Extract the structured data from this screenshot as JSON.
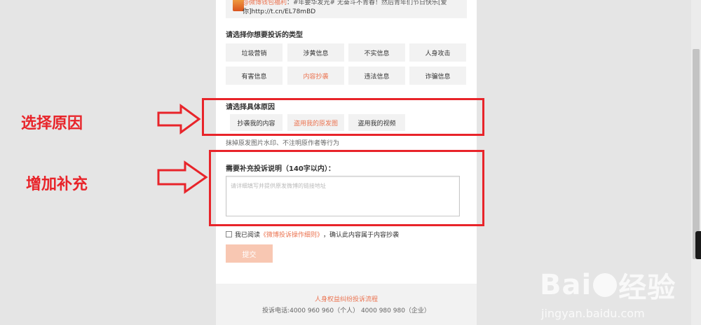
{
  "quote": {
    "line1_mention": "@微博钱包福利",
    "line1_rest": "：#年要华发光# 无奋斗不青春！然后青年们节日快乐[爱",
    "line2": "你]http://t.cn/EL78mBD"
  },
  "complaint_type": {
    "title": "请选择你想要投诉的类型",
    "options": [
      "垃圾营销",
      "涉黄信息",
      "不实信息",
      "人身攻击",
      "有害信息",
      "内容抄袭",
      "违法信息",
      "诈骗信息"
    ],
    "selected": "内容抄袭"
  },
  "specific_reason": {
    "title": "请选择具体原因",
    "options": [
      "抄袭我的内容",
      "盗用我的原发图",
      "盗用我的视频"
    ],
    "selected": "盗用我的原发图",
    "hint": "抹掉原发图片水印、不注明原作者等行为"
  },
  "supplement": {
    "title": "需要补充投诉说明（140字以内）：",
    "placeholder": "请详细填写并提供原发微博的链接地址"
  },
  "agreement": {
    "prefix": "我已阅读",
    "link": "《微博投诉操作细则》",
    "suffix": "，确认此内容属于内容抄袭"
  },
  "submit_label": "提交",
  "footer": {
    "link": "人身权益纠纷投诉流程",
    "phone": "投诉电话:4000 960 960（个人） 4000 980 980（企业）"
  },
  "annotations": {
    "reason": "选择原因",
    "supplement": "增加补充"
  },
  "watermark": {
    "brand_left": "Bai",
    "brand_right": "经验",
    "url": "jingyan.baidu.com"
  },
  "colors": {
    "accent": "#eb7350",
    "annotation_red": "#e8242a",
    "submit_disabled": "#f8c7b2"
  }
}
